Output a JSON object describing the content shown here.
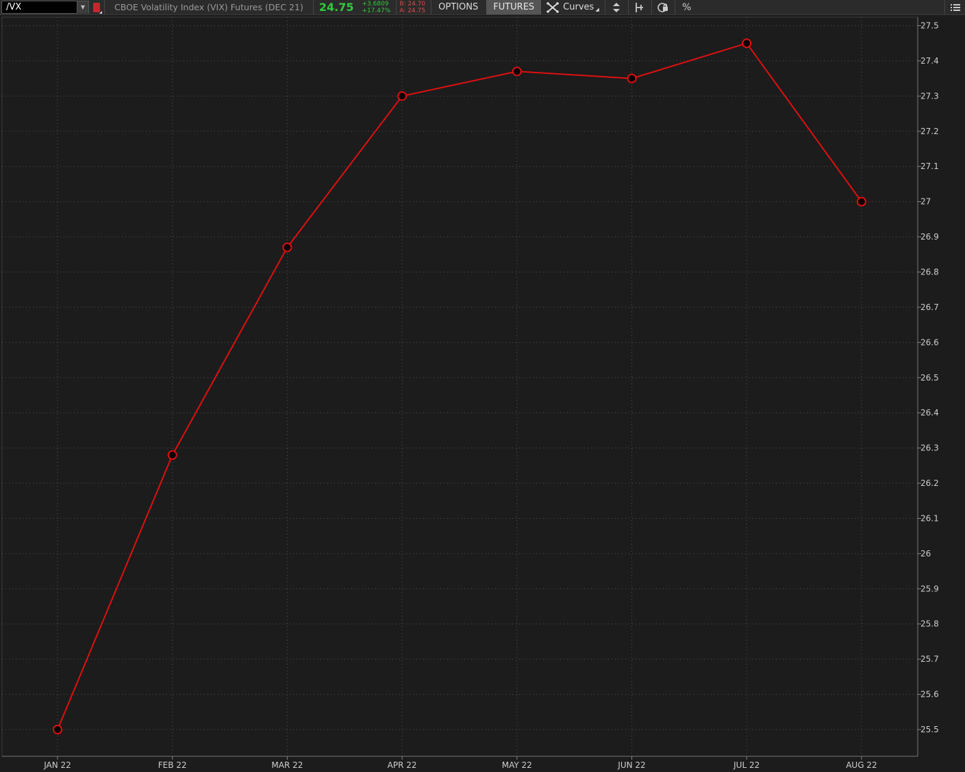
{
  "toolbar": {
    "symbol": "/VX",
    "description": "CBOE Volatility Index (VIX) Futures (DEC 21)",
    "last_price": "24.75",
    "net_change": "+3.6809",
    "pct_change": "+17.47%",
    "bid": "B: 24.70",
    "ask": "A: 24.75",
    "options_label": "OPTIONS",
    "futures_label": "FUTURES",
    "curves_label": "Curves",
    "percent_label": "%"
  },
  "colors": {
    "background": "#1c1c1c",
    "line": "#e01010",
    "grid": "#555555",
    "price_up": "#2fcb3c",
    "price_down": "#e04848"
  },
  "chart_data": {
    "type": "line",
    "categories": [
      "JAN 22",
      "FEB 22",
      "MAR 22",
      "APR 22",
      "MAY 22",
      "JUN 22",
      "JUL 22",
      "AUG 22"
    ],
    "series": [
      {
        "values": [
          25.5,
          26.28,
          26.87,
          27.3,
          27.37,
          27.35,
          27.45,
          27.0
        ]
      }
    ],
    "y_ticks": [
      "25.5",
      "25.6",
      "25.7",
      "25.8",
      "25.9",
      "26",
      "26.1",
      "26.2",
      "26.3",
      "26.4",
      "26.5",
      "26.6",
      "26.7",
      "26.8",
      "26.9",
      "27",
      "27.1",
      "27.2",
      "27.3",
      "27.4",
      "27.5"
    ],
    "ylim": [
      25.5,
      27.5
    ],
    "y_axis_side": "right",
    "grid": true,
    "marker": "circle"
  }
}
